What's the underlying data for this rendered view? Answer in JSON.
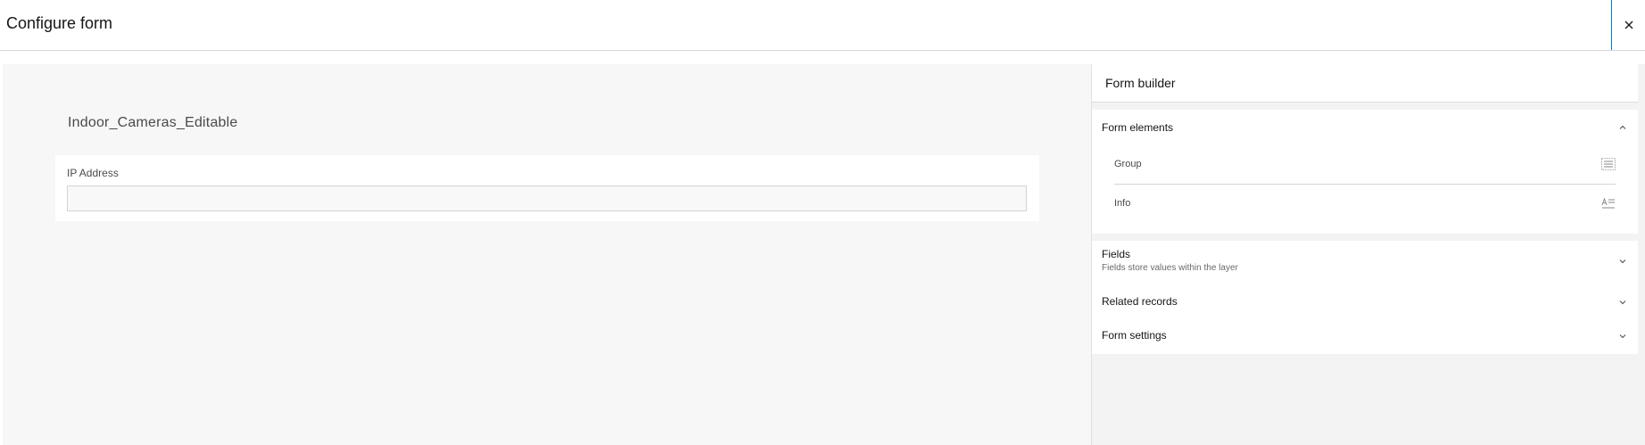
{
  "header": {
    "title": "Configure form",
    "close_symbol": "×"
  },
  "canvas": {
    "form_title": "Indoor_Cameras_Editable",
    "field": {
      "label": "IP Address",
      "value": ""
    }
  },
  "panel": {
    "title": "Form builder",
    "form_elements": {
      "title": "Form elements",
      "items": [
        {
          "label": "Group",
          "icon": "group-icon"
        },
        {
          "label": "Info",
          "icon": "text-info-icon"
        }
      ]
    },
    "fields": {
      "title": "Fields",
      "subtitle": "Fields store values within the layer"
    },
    "related_records": {
      "title": "Related records"
    },
    "form_settings": {
      "title": "Form settings"
    }
  },
  "colors": {
    "accent": "#007ac2",
    "canvas_bg": "#f7f7f7",
    "panel_bg": "#f3f3f3",
    "border": "#d4d4d4"
  }
}
